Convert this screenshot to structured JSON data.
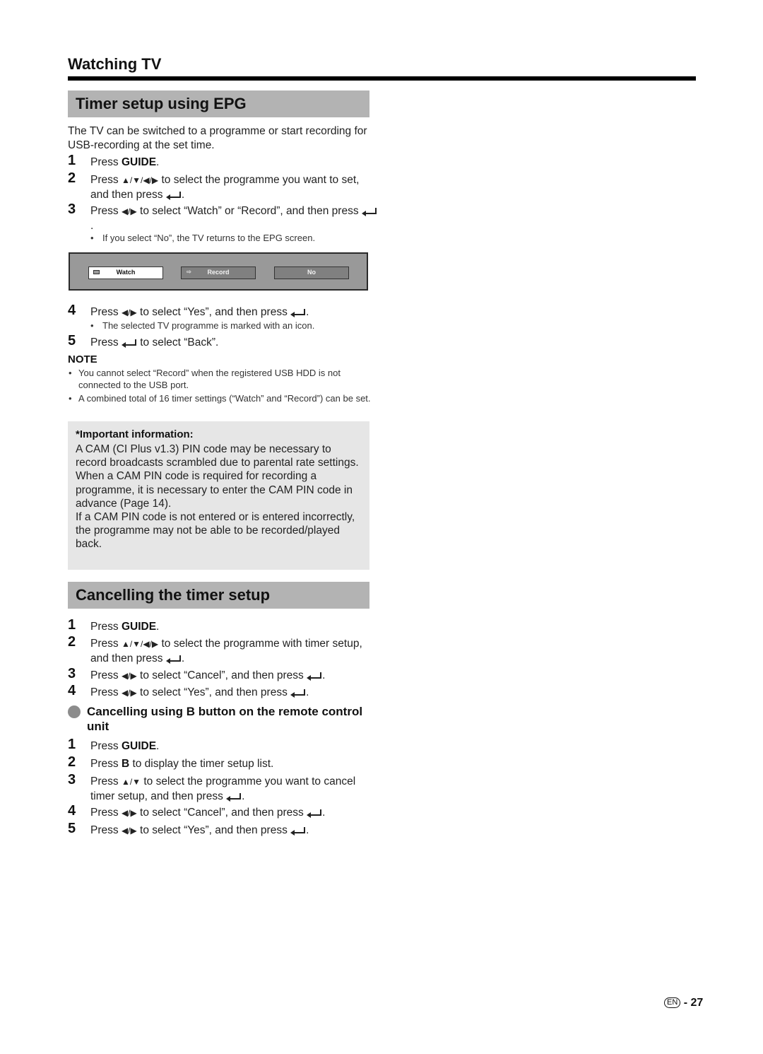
{
  "chapter": {
    "title": "Watching TV"
  },
  "section1": {
    "title": "Timer setup using EPG",
    "intro": "The TV can be switched to a programme or start recording for USB-recording at the set time.",
    "steps": [
      {
        "num": "1",
        "pre": "Press ",
        "bold": "GUIDE",
        "post": "."
      },
      {
        "num": "2",
        "pre": "Press ",
        "keys": "▲/▼/◀/▶",
        "post": " to select the programme you want to set, and then press ",
        "enter": true,
        "end": "."
      },
      {
        "num": "3",
        "pre": "Press ",
        "keys": "◀/▶",
        "post": " to select “Watch” or “Record”, and then press ",
        "enter": true,
        "end": ".",
        "bullet": "If you select “No”, the TV returns to the EPG screen."
      },
      {
        "num": "4",
        "pre": "Press ",
        "keys": "◀/▶",
        "post": " to select “Yes”, and then press ",
        "enter": true,
        "end": ".",
        "bullet": "The selected TV programme is marked with an icon."
      },
      {
        "num": "5",
        "pre": "Press ",
        "enter": true,
        "post": " to select “Back”."
      }
    ],
    "dialog": {
      "buttons": [
        {
          "label": "Watch",
          "icon": "watch-icon",
          "selected": true
        },
        {
          "label": "Record",
          "icon": "record-icon",
          "selected": false
        },
        {
          "label": "No",
          "selected": false
        }
      ]
    },
    "note": {
      "title": "NOTE",
      "items": [
        "You cannot select “Record” when the registered USB HDD is not connected to the USB port.",
        "A combined total of 16 timer settings (“Watch” and “Record”) can be set."
      ]
    },
    "important": {
      "title": "*Important information:",
      "paragraphs": [
        "A CAM (CI Plus v1.3) PIN code may be necessary to record broadcasts scrambled due to parental rate settings.",
        "When a CAM PIN code is required for recording a programme, it is necessary to enter the CAM PIN code in advance (Page 14).",
        "If a CAM PIN code is not entered or is entered incorrectly, the programme may not be able to be recorded/played back."
      ]
    }
  },
  "section2": {
    "title": "Cancelling the timer setup",
    "steps": [
      {
        "num": "1",
        "pre": "Press ",
        "bold": "GUIDE",
        "post": "."
      },
      {
        "num": "2",
        "pre": "Press ",
        "keys": "▲/▼/◀/▶",
        "post": " to select the programme with timer setup, and then press ",
        "enter": true,
        "end": "."
      },
      {
        "num": "3",
        "pre": "Press ",
        "keys": "◀/▶",
        "post": " to select “Cancel”, and then press ",
        "enter": true,
        "end": "."
      },
      {
        "num": "4",
        "pre": "Press ",
        "keys": "◀/▶",
        "post": " to select “Yes”, and then press ",
        "enter": true,
        "end": "."
      }
    ],
    "subsection": {
      "title": "Cancelling using B button on the remote control unit",
      "steps": [
        {
          "num": "1",
          "pre": "Press ",
          "bold": "GUIDE",
          "post": "."
        },
        {
          "num": "2",
          "pre": "Press ",
          "bold": "B",
          "post": " to display the timer setup list."
        },
        {
          "num": "3",
          "pre": "Press ",
          "keys": "▲/▼",
          "post": " to select the programme you want to cancel timer setup, and then press ",
          "enter": true,
          "end": "."
        },
        {
          "num": "4",
          "pre": "Press ",
          "keys": "◀/▶",
          "post": " to select “Cancel”, and then press ",
          "enter": true,
          "end": "."
        },
        {
          "num": "5",
          "pre": "Press ",
          "keys": "◀/▶",
          "post": " to select “Yes”, and then press ",
          "enter": true,
          "end": "."
        }
      ]
    }
  },
  "footer": {
    "lang": "EN",
    "separator": "-",
    "page": "27"
  }
}
